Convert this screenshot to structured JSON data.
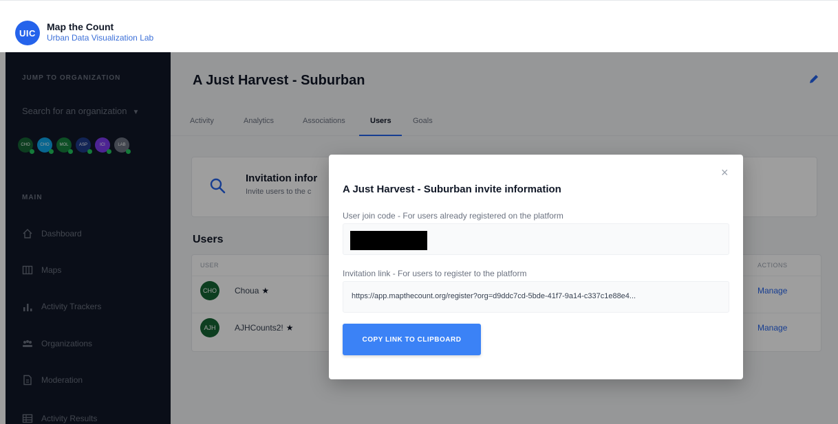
{
  "header": {
    "logo_text": "UIC",
    "title": "Map the Count",
    "subtitle": "Urban Data Visualization Lab"
  },
  "sidebar": {
    "jump_heading": "JUMP TO ORGANIZATION",
    "search_placeholder": "Search for an organization",
    "org_avatars": [
      {
        "label": "CHO",
        "color": "#166534"
      },
      {
        "label": "CHO",
        "color": "#0ea5e9"
      },
      {
        "label": "MOL",
        "color": "#15803d"
      },
      {
        "label": "ASP",
        "color": "#1e3a8a"
      },
      {
        "label": "ICI",
        "color": "#7c3aed"
      },
      {
        "label": "LAB",
        "color": "#6b7280"
      }
    ],
    "main_heading": "MAIN",
    "items": [
      {
        "label": "Dashboard",
        "icon": "home-icon"
      },
      {
        "label": "Maps",
        "icon": "map-icon"
      },
      {
        "label": "Activity Trackers",
        "icon": "bar-chart-icon"
      },
      {
        "label": "Organizations",
        "icon": "people-icon"
      },
      {
        "label": "Moderation",
        "icon": "document-icon"
      },
      {
        "label": "Activity Results",
        "icon": "table-icon"
      }
    ]
  },
  "main": {
    "org_title": "A Just Harvest - Suburban",
    "tabs": [
      {
        "label": "Activity"
      },
      {
        "label": "Analytics"
      },
      {
        "label": "Associations"
      },
      {
        "label": "Users"
      },
      {
        "label": "Goals"
      }
    ],
    "active_tab": "Users",
    "invite_card": {
      "title": "Invitation infor",
      "subtitle": "Invite users to the c"
    },
    "users_heading": "Users",
    "table": {
      "columns": [
        "USER",
        "ACTIONS"
      ],
      "rows": [
        {
          "initials": "CHO",
          "name": "Choua",
          "action": "Manage"
        },
        {
          "initials": "AJH",
          "name": "AJHCounts2!",
          "action": "Manage"
        }
      ]
    }
  },
  "modal": {
    "title": "A Just Harvest - Suburban invite information",
    "join_code_label": "User join code - For users already registered on the platform",
    "invite_link_label": "Invitation link - For users to register to the platform",
    "invite_link": "https://app.mapthecount.org/register?org=d9ddc7cd-5bde-41f7-9a14-c337c1e88e4...",
    "copy_button": "COPY LINK TO CLIPBOARD",
    "close_symbol": "×"
  },
  "colors": {
    "accent": "#2563eb",
    "sidebar_bg": "#111827",
    "button": "#3b82f6"
  }
}
